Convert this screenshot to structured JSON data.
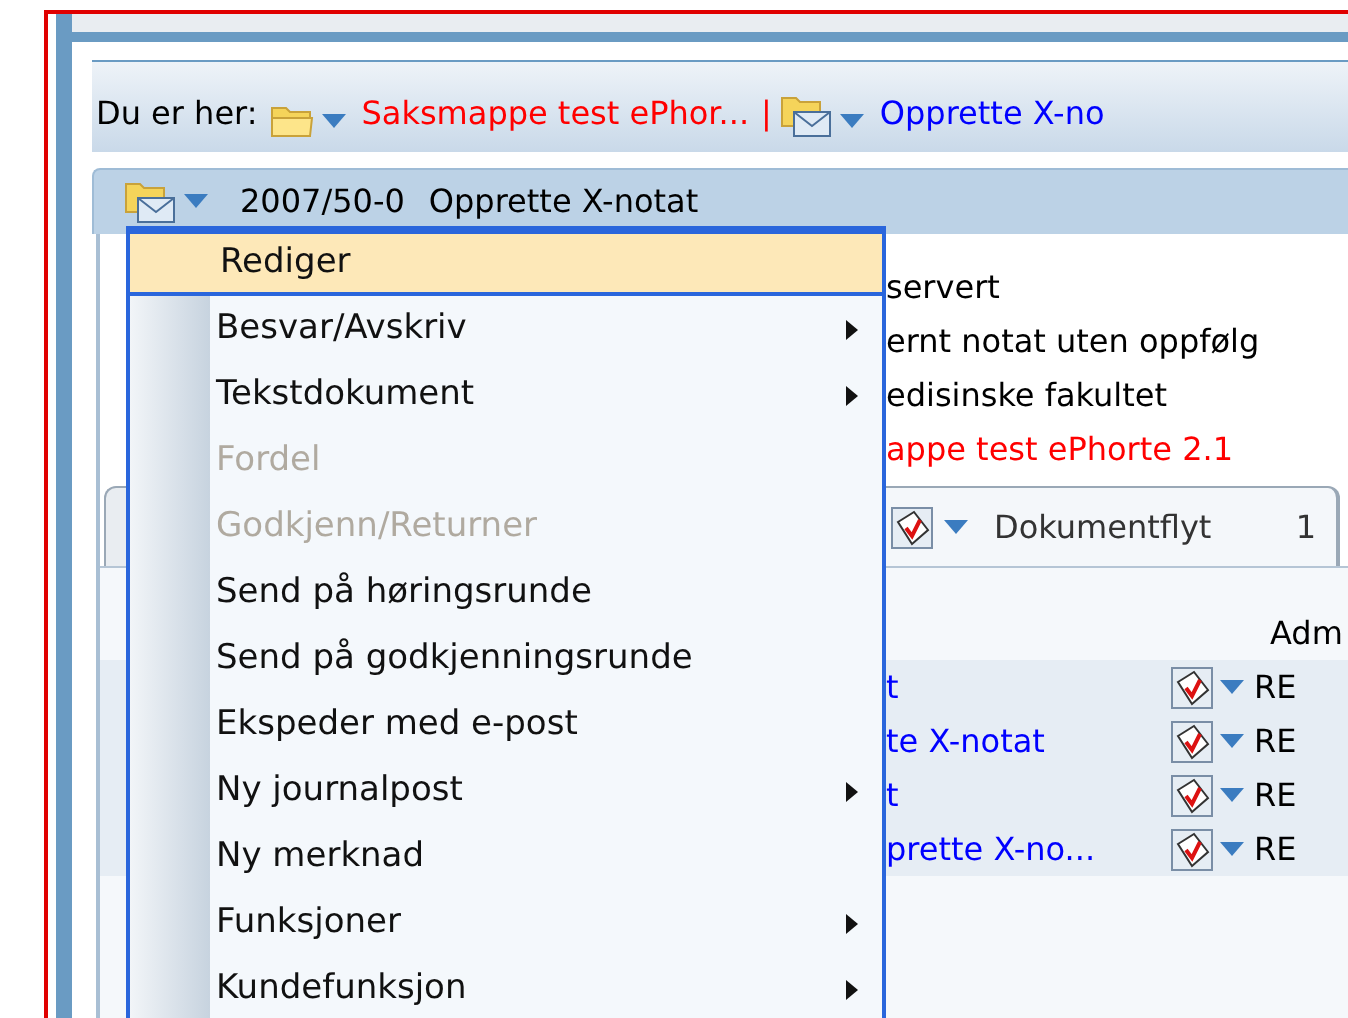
{
  "breadcrumb": {
    "label": "Du er her:",
    "separator": "|",
    "items": [
      {
        "text": "Saksmappe test ePhor...",
        "kind": "case"
      },
      {
        "text": "Opprette X-no",
        "kind": "note"
      }
    ]
  },
  "header": {
    "number": "2007/50-0",
    "title": "Opprette X-notat"
  },
  "details": [
    {
      "text": "servert",
      "kind": "plain"
    },
    {
      "text": "ernt notat uten oppfølg",
      "kind": "plain"
    },
    {
      "text": "edisinske fakultet",
      "kind": "plain"
    },
    {
      "text": "appe test ePhorte 2.1",
      "kind": "link"
    }
  ],
  "tabs": [
    {
      "label": "Dokumentflyt",
      "count": "1",
      "selected": true
    }
  ],
  "table": {
    "columns": [
      "Adm"
    ],
    "rows": [
      {
        "title": "t",
        "admin": "RE"
      },
      {
        "title": "te X-notat",
        "admin": "RE"
      },
      {
        "title": "t",
        "admin": "RE"
      },
      {
        "title": "prette X-no...",
        "admin": "RE"
      }
    ]
  },
  "menu": {
    "items": [
      {
        "label": "Rediger",
        "selected": true,
        "disabled": false,
        "submenu": false
      },
      {
        "label": "Besvar/Avskriv",
        "selected": false,
        "disabled": false,
        "submenu": true
      },
      {
        "label": "Tekstdokument",
        "selected": false,
        "disabled": false,
        "submenu": true
      },
      {
        "label": "Fordel",
        "selected": false,
        "disabled": true,
        "submenu": false
      },
      {
        "label": "Godkjenn/Returner",
        "selected": false,
        "disabled": true,
        "submenu": false
      },
      {
        "label": "Send på høringsrunde",
        "selected": false,
        "disabled": false,
        "submenu": false
      },
      {
        "label": "Send på godkjenningsrunde",
        "selected": false,
        "disabled": false,
        "submenu": false
      },
      {
        "label": "Ekspeder med e-post",
        "selected": false,
        "disabled": false,
        "submenu": false
      },
      {
        "label": "Ny journalpost",
        "selected": false,
        "disabled": false,
        "submenu": true
      },
      {
        "label": "Ny merknad",
        "selected": false,
        "disabled": false,
        "submenu": false
      },
      {
        "label": "Funksjoner",
        "selected": false,
        "disabled": false,
        "submenu": true
      },
      {
        "label": "Kundefunksjon",
        "selected": false,
        "disabled": false,
        "submenu": true
      }
    ]
  }
}
